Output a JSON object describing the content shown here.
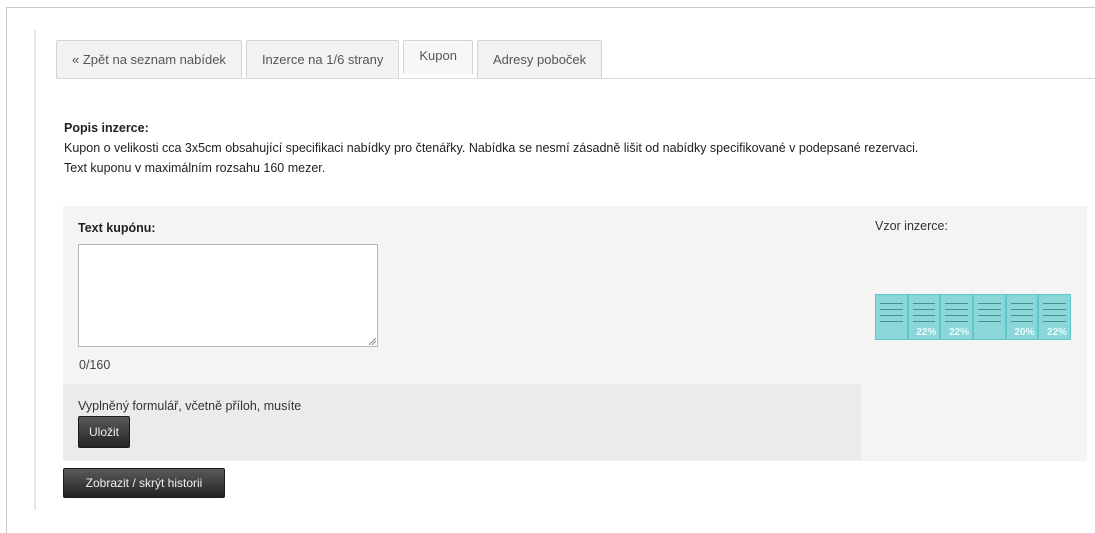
{
  "tabs": [
    {
      "label": "« Zpět na seznam nabídek",
      "active": false
    },
    {
      "label": "Inzerce na 1/6 strany",
      "active": false
    },
    {
      "label": "Kupon",
      "active": true
    },
    {
      "label": "Adresy poboček",
      "active": false
    }
  ],
  "description": {
    "title": "Popis inzerce:",
    "line1": "Kupon o velikosti cca 3x5cm obsahující specifikaci nabídky pro čtenářky. Nabídka se nesmí zásadně lišit od nabídky specifikované v podepsané rezervaci.",
    "line2": "Text kuponu v maximálním rozsahu 160 mezer."
  },
  "form": {
    "coupon_label": "Text kupónu:",
    "coupon_value": "",
    "counter": "0/160",
    "note": "Vyplněný formulář, včetně příloh, musíte",
    "save_label": "Uložit"
  },
  "sample": {
    "label": "Vzor inzerce:",
    "coupons": [
      {
        "percent": ""
      },
      {
        "percent": "22%"
      },
      {
        "percent": "22%"
      },
      {
        "percent": ""
      },
      {
        "percent": "20%"
      },
      {
        "percent": "22%"
      }
    ]
  },
  "history_button_label": "Zobrazit / skrýt historii",
  "colors": {
    "button_dark": "#2a2a2a",
    "panel_bg": "#f4f4f4",
    "sample_teal": "#5cc7cc"
  }
}
